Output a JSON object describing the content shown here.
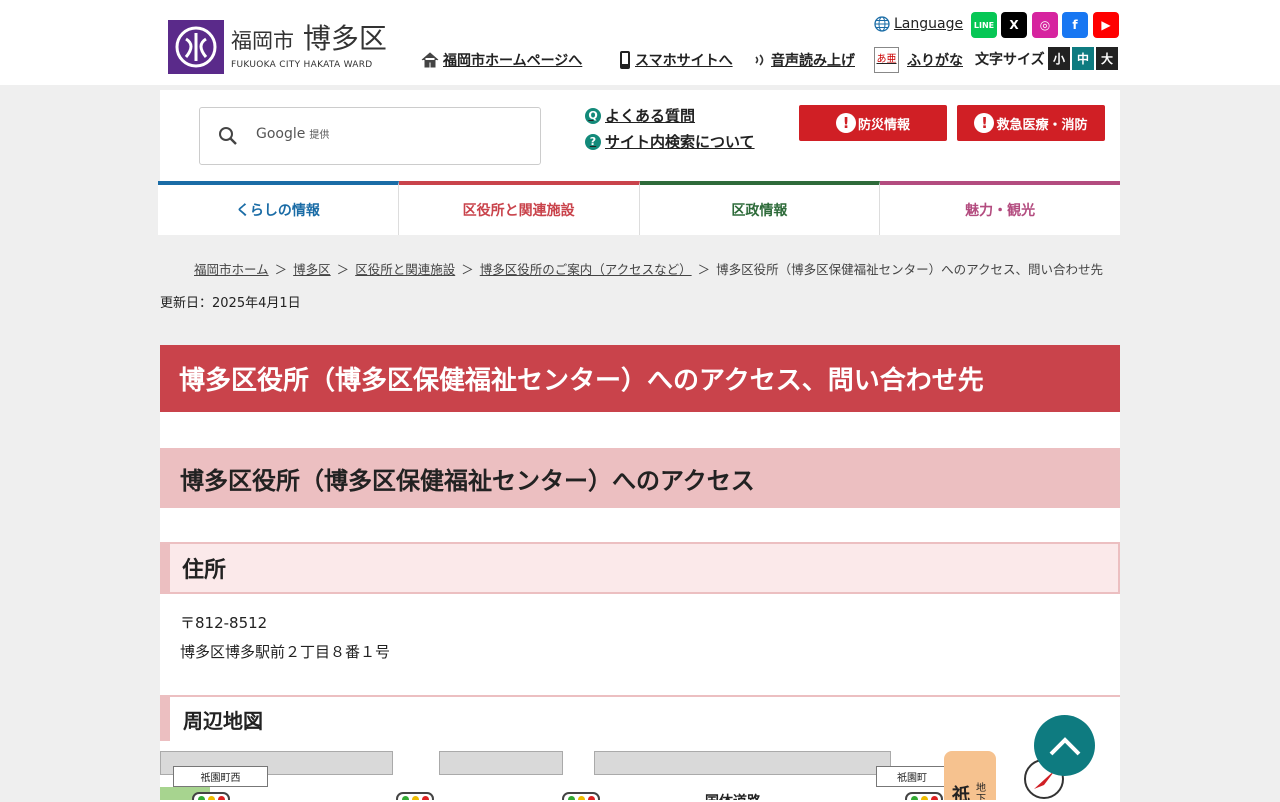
{
  "logo": {
    "name_ja": "福岡市",
    "name_ward": "博多区",
    "name_en": "FUKUOKA CITY HAKATA WARD"
  },
  "header": {
    "language": "Language",
    "home_link": "福岡市ホームページへ",
    "smartphone_link": "スマホサイトへ",
    "voice_link": "音声読み上げ",
    "furigana_link": "ふりがな",
    "furigana_icon_text": "あ亜",
    "font_size_label": "文字サイズ",
    "font_size_small": "小",
    "font_size_medium": "中",
    "font_size_large": "大",
    "sns": [
      {
        "name": "line-icon",
        "text": "LINE",
        "color": "#06c755"
      },
      {
        "name": "x-icon",
        "text": "X",
        "color": "#000000"
      },
      {
        "name": "instagram-icon",
        "text": "◎",
        "color": "#d6249f"
      },
      {
        "name": "facebook-icon",
        "text": "f",
        "color": "#1877f2"
      },
      {
        "name": "youtube-icon",
        "text": "▶",
        "color": "#ff0000"
      }
    ]
  },
  "search": {
    "brand": "Google",
    "brand_suffix": "提供"
  },
  "help": {
    "faq": "よくある質問",
    "site_search": "サイト内検索について"
  },
  "alerts": {
    "disaster": "防災情報",
    "emergency": "救急医療・消防"
  },
  "nav": [
    {
      "label": "くらしの情報",
      "color": "#1a6ca6"
    },
    {
      "label": "区役所と関連施設",
      "color": "#c9434b"
    },
    {
      "label": "区政情報",
      "color": "#2e6b3a"
    },
    {
      "label": "魅力・観光",
      "color": "#b34c7f"
    }
  ],
  "breadcrumb": {
    "sep": "＞",
    "items": [
      "福岡市ホーム",
      "博多区",
      "区役所と関連施設",
      "博多区役所のご案内（アクセスなど）"
    ],
    "current": "博多区役所（博多区保健福祉センター）へのアクセス、問い合わせ先"
  },
  "updated": "更新日：2025年4月1日",
  "page": {
    "title": "博多区役所（博多区保健福祉センター）へのアクセス、問い合わせ先",
    "section_title": "博多区役所（博多区保健福祉センター）へのアクセス",
    "address_heading": "住所",
    "postal": "〒812-8512",
    "address": "博多区博多駅前２丁目８番１号",
    "map_heading": "周辺地図"
  },
  "map": {
    "label_west": "祇園町西",
    "label_east": "祇園町",
    "road": "国体道路",
    "station_char": "祇",
    "station_sub": "地下"
  },
  "colors": {
    "accent_red": "#c9434b",
    "pagetop": "#0e7b80"
  }
}
